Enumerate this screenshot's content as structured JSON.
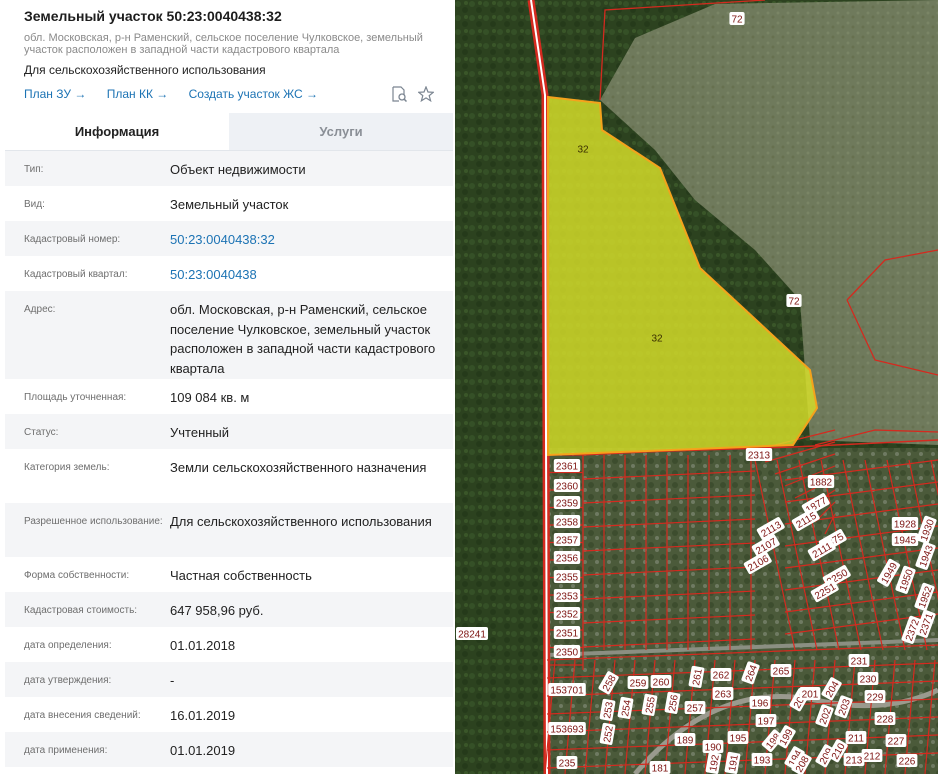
{
  "header": {
    "title": "Земельный участок 50:23:0040438:32",
    "address": "обл. Московская, р-н Раменский, сельское поселение Чулковское, земельный участок расположен в западной части кадастрового квартала",
    "use": "Для сельскохозяйственного использования",
    "links": [
      "План ЗУ →",
      "План КК →",
      "Создать участок ЖС →"
    ]
  },
  "tabs": [
    "Информация",
    "Услуги"
  ],
  "rows": [
    {
      "label": "Тип:",
      "value": "Объект недвижимости"
    },
    {
      "label": "Вид:",
      "value": "Земельный участок"
    },
    {
      "label": "Кадастровый номер:",
      "value": "50:23:0040438:32",
      "link": true
    },
    {
      "label": "Кадастровый квартал:",
      "value": "50:23:0040438",
      "link": true
    },
    {
      "label": "Адрес:",
      "value": "обл. Московская, р-н Раменский, сельское поселение Чулковское, земельный участок расположен в западной части кадастрового квартала"
    },
    {
      "label": "Площадь уточненная:",
      "value": "109 084 кв. м"
    },
    {
      "label": "Статус:",
      "value": "Учтенный"
    },
    {
      "label": "Категория земель:",
      "value": "Земли сельскохозяйственного назначения"
    },
    {
      "label": "Разрешенное использование:",
      "value": "Для сельскохозяйственного использования"
    },
    {
      "label": "Форма собственности:",
      "value": "Частная собственность"
    },
    {
      "label": "Кадастровая стоимость:",
      "value": "647 958,96 руб."
    },
    {
      "label": "дата определения:",
      "value": "01.01.2018"
    },
    {
      "label": "дата утверждения:",
      "value": "-"
    },
    {
      "label": "дата внесения сведений:",
      "value": "16.01.2019"
    },
    {
      "label": "дата применения:",
      "value": "01.01.2019"
    }
  ],
  "map": {
    "selected_parcel": "32",
    "neighbor_parcel": "72",
    "parcel_labels": [
      "28241",
      "2361",
      "2360",
      "2359",
      "2358",
      "2357",
      "2356",
      "2355",
      "2353",
      "2352",
      "2351",
      "2350",
      "2313",
      "1882",
      "1877",
      "2115",
      "2113",
      "2107",
      "2106",
      "1875",
      "2111",
      "2250",
      "2251",
      "1928",
      "1945",
      "1930",
      "1943",
      "1949",
      "1950",
      "1952",
      "2372",
      "2371",
      "231",
      "230",
      "229",
      "228",
      "227",
      "226",
      "153701",
      "153693",
      "235",
      "258",
      "259",
      "260",
      "261",
      "262",
      "263",
      "264",
      "265",
      "196",
      "197",
      "198",
      "199",
      "200",
      "201",
      "202",
      "203",
      "204",
      "189",
      "190",
      "191",
      "192",
      "193",
      "194",
      "195",
      "181",
      "208",
      "209",
      "210",
      "211",
      "212",
      "213",
      "252",
      "253",
      "254",
      "255",
      "256",
      "257"
    ],
    "colors": {
      "boundary": "#d42a1f",
      "selected_fill": "#d8e02a",
      "selected_stroke": "#f5a21c",
      "label_text": "#7d1412"
    }
  }
}
